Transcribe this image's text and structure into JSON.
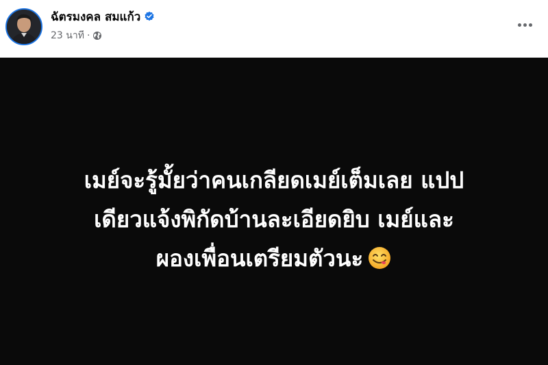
{
  "post": {
    "author": {
      "name": "ฉัตรมงคล สมแก้ว",
      "verified_icon": "verified-badge-icon"
    },
    "meta": {
      "timestamp": "23 นาที",
      "separator": "·",
      "privacy_icon": "globe-icon"
    },
    "more_icon": "more-options-icon",
    "body": {
      "lines": [
        "เมย์จะรู้มั้ยว่าคนเกลียดเมย์เต็มเลย แปป",
        "เดียวแจ้งพิกัดบ้านละเอียดยิบ เมย์และ",
        "ผองเพื่อนเตรียมตัวนะ"
      ],
      "emoji_icon": "smiling-face-savoring-food-emoji",
      "background_color": "#0a0a0a",
      "text_color": "#ffffff"
    }
  },
  "colors": {
    "accent": "#1b74e4",
    "secondary_text": "#65676b",
    "primary_text": "#050505"
  }
}
